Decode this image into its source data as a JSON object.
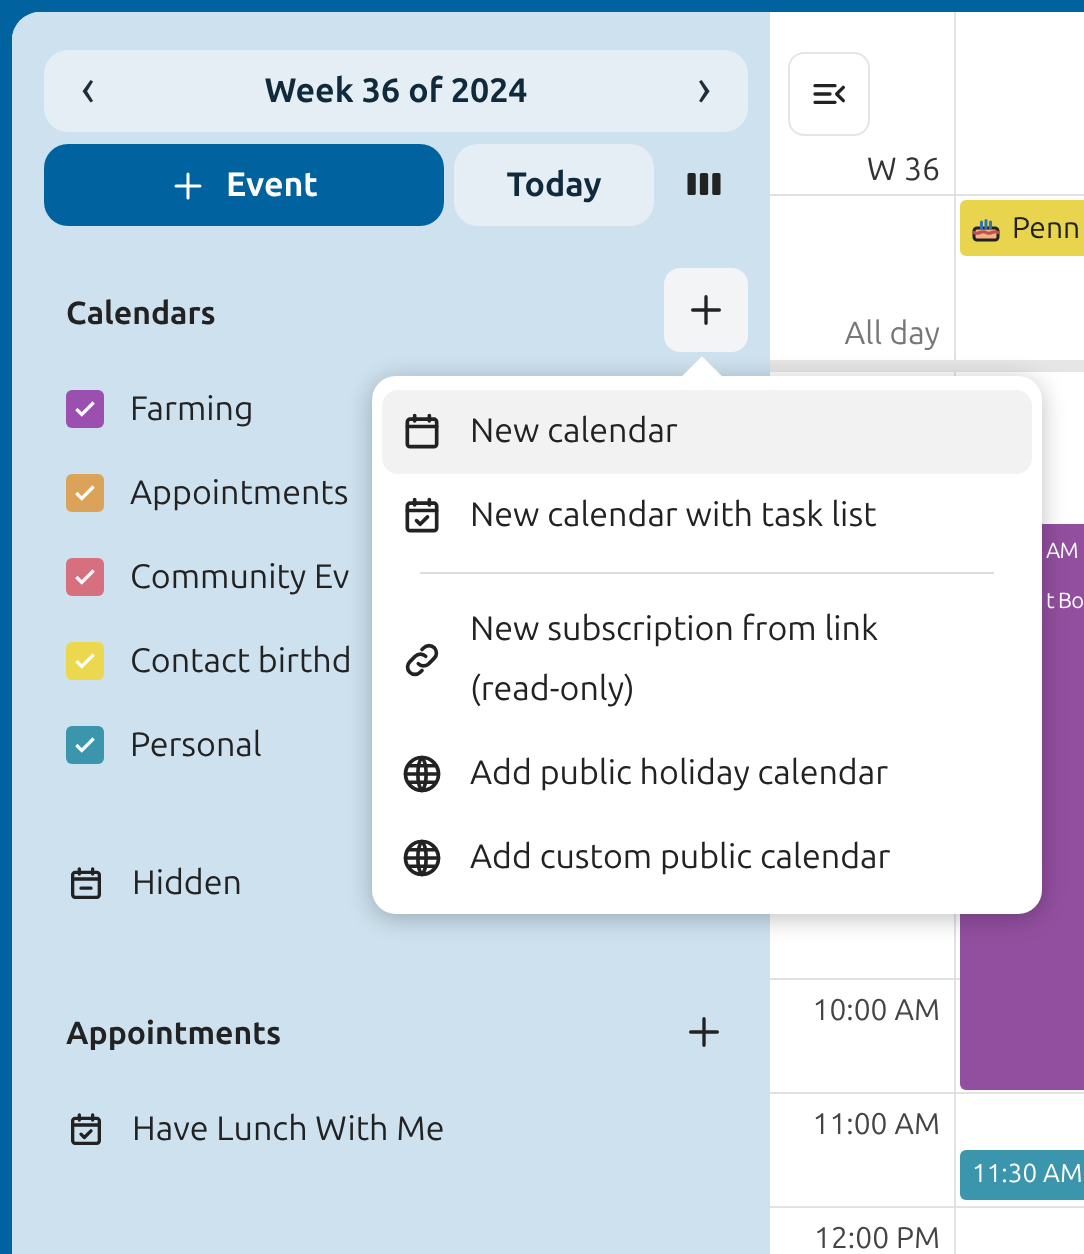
{
  "navigation": {
    "prev": "‹",
    "title": "Week 36 of 2024",
    "next": "›"
  },
  "actions": {
    "new_event": "Event",
    "today": "Today"
  },
  "calendars": {
    "heading": "Calendars",
    "items": [
      {
        "name": "Farming",
        "checked": true,
        "color": "#9b4fae"
      },
      {
        "name": "Appointments",
        "checked": true,
        "color": "#dba35a"
      },
      {
        "name": "Community Ev",
        "checked": true,
        "color": "#d6707f"
      },
      {
        "name": "Contact birthd",
        "checked": true,
        "color": "#ecd84e"
      },
      {
        "name": "Personal",
        "checked": true,
        "color": "#3b95ad"
      }
    ],
    "hidden": "Hidden"
  },
  "appointments": {
    "heading": "Appointments",
    "items": [
      "Have Lunch With Me"
    ]
  },
  "menu": {
    "items": [
      {
        "kind": "calendar",
        "label": "New calendar",
        "selected": true
      },
      {
        "kind": "tasks",
        "label": "New calendar with task list",
        "selected": false
      },
      {
        "kind": "divider"
      },
      {
        "kind": "link",
        "label": "New subscription from link (read-only)",
        "selected": false
      },
      {
        "kind": "globe",
        "label": "Add public holiday calendar",
        "selected": false
      },
      {
        "kind": "globe",
        "label": "Add custom public calendar",
        "selected": false
      }
    ]
  },
  "grid": {
    "week": "W 36",
    "all_day": "All day",
    "hours": [
      "10:00 AM",
      "11:00 AM",
      "12:00 PM"
    ],
    "events": [
      {
        "kind": "allday",
        "text": "Penn",
        "color": "#e8d44d"
      },
      {
        "kind": "block",
        "lines": [
          "AM",
          "t Bo"
        ],
        "color": "#924f9f"
      },
      {
        "kind": "short",
        "text": "11:30 AM",
        "color": "#3b95ad"
      }
    ]
  }
}
